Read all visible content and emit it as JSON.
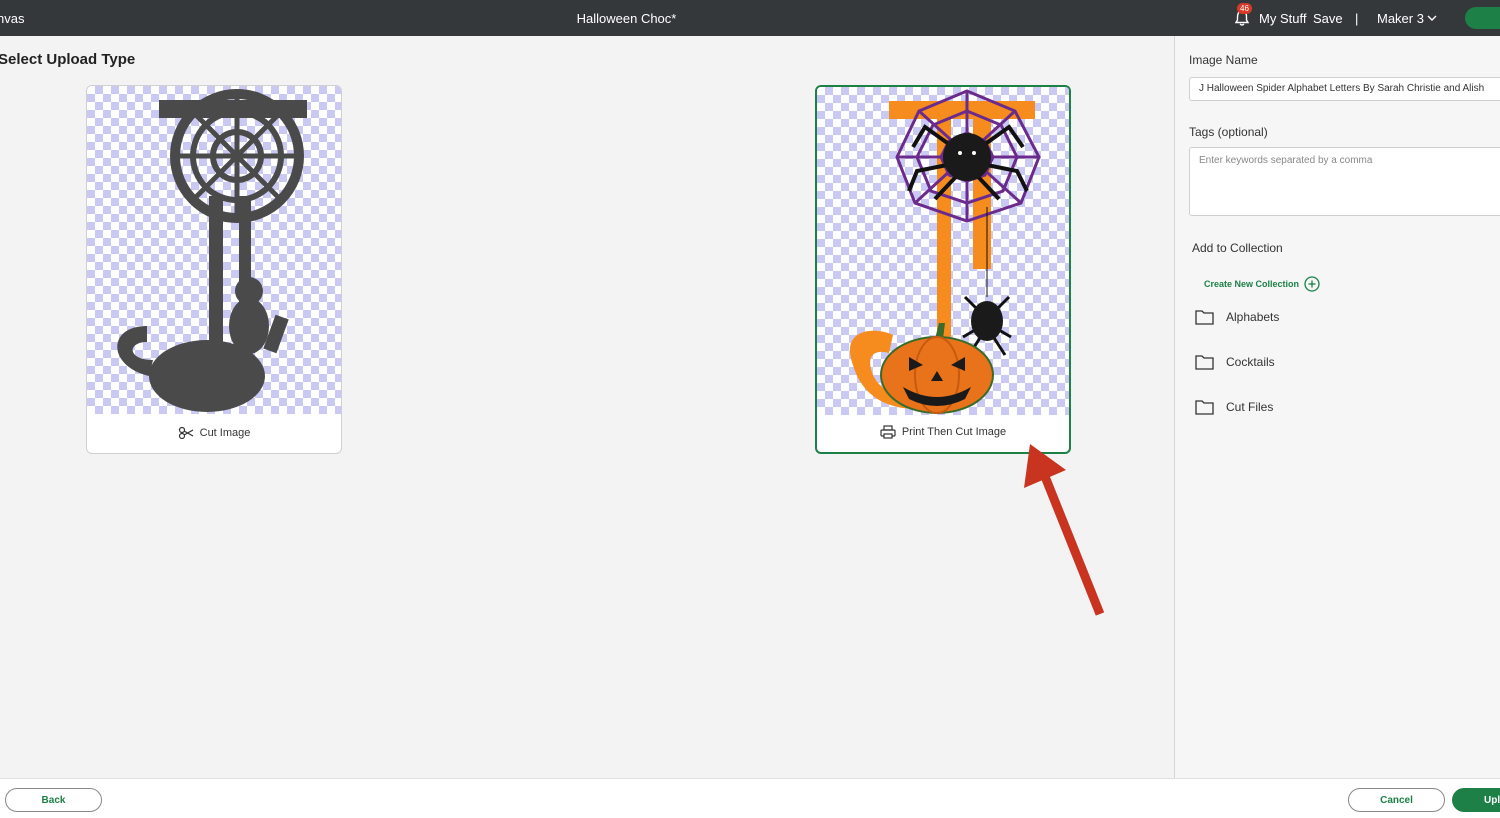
{
  "topbar": {
    "left_title": "nvas",
    "document_title": "Halloween Choc*",
    "notification_count": "46",
    "my_stuff": "My Stuff",
    "save": "Save",
    "separator": "|",
    "machine": "Maker 3",
    "icons": [
      "bell-icon",
      "chevron-down-icon"
    ]
  },
  "main": {
    "heading": "Select Upload Type",
    "cards": [
      {
        "label": "Cut Image",
        "icon": "scissors-icon",
        "selected": false
      },
      {
        "label": "Print Then Cut Image",
        "icon": "printer-icon",
        "selected": true
      }
    ]
  },
  "sidepanel": {
    "image_name_label": "Image Name",
    "image_name_value": "J Halloween Spider Alphabet Letters By Sarah Christie and Alish",
    "tags_label": "Tags (optional)",
    "tags_placeholder": "Enter keywords separated by a comma",
    "collection_label": "Add to Collection",
    "create_collection": "Create New Collection",
    "folders": [
      "Alphabets",
      "Cocktails",
      "Cut Files"
    ]
  },
  "footer": {
    "back": "Back",
    "cancel": "Cancel",
    "upload": "Upl"
  },
  "colors": {
    "accent_green": "#1d8147",
    "topbar": "#34383b",
    "arrow_red": "#c8341f",
    "pumpkin_orange": "#f68c1e",
    "silhouette_gray": "#4a4a4a"
  }
}
